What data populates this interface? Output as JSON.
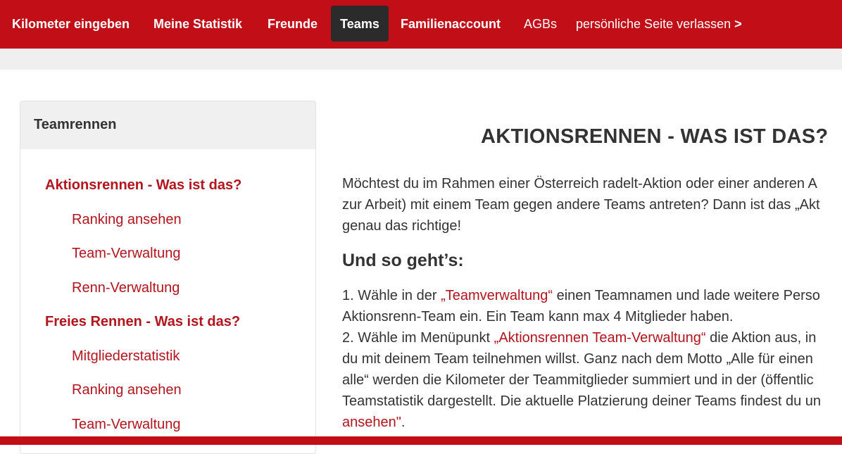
{
  "nav": {
    "items": [
      {
        "label": "Kilometer eingeben"
      },
      {
        "label": "Meine Statistik"
      },
      {
        "label": "Freunde"
      },
      {
        "label": "Teams"
      },
      {
        "label": "Familienaccount"
      },
      {
        "label": "AGBs"
      },
      {
        "label": "persönliche Seite verlassen",
        "arrow": ">"
      }
    ]
  },
  "sidebar": {
    "title": "Teamrennen",
    "items": [
      {
        "label": "Aktionsrennen - Was ist das?"
      },
      {
        "label": "Ranking ansehen"
      },
      {
        "label": "Team-Verwaltung"
      },
      {
        "label": "Renn-Verwaltung"
      },
      {
        "label": "Freies Rennen - Was ist das?"
      },
      {
        "label": "Mitgliederstatistik"
      },
      {
        "label": "Ranking ansehen"
      },
      {
        "label": "Team-Verwaltung"
      }
    ]
  },
  "main": {
    "title": "AKTIONSRENNEN - WAS IST DAS?",
    "intro": {
      "line1": "Möchtest du im Rahmen einer Österreich radelt-Aktion oder einer anderen A",
      "line2": "zur Arbeit) mit einem Team gegen andere Teams antreten? Dann ist das „Akt",
      "line3": "genau das richtige!"
    },
    "subheading": "Und so geht’s:",
    "steps": {
      "l1_pre": "1. Wähle in der ",
      "l1_link": "„Teamverwaltung“",
      "l1_post": " einen Teamnamen und lade weitere Perso",
      "l2": "Aktionsrenn-Team ein. Ein Team kann max 4 Mitglieder haben.",
      "l3_pre": "2. Wähle im Menüpunkt ",
      "l3_link": "„Aktionsrennen Team-Verwaltung“",
      "l3_post": " die Aktion aus, in",
      "l4": "du mit deinem Team teilnehmen willst. Ganz nach dem Motto „Alle für einen",
      "l5": "alle“ werden die Kilometer der Teammitglieder summiert und in der (öffentlic",
      "l6": "Teamstatistik dargestellt. Die aktuelle Platzierung deiner Teams findest du un",
      "l7_link": "ansehen\"",
      "l7_post": "."
    }
  },
  "colors": {
    "brand_red": "#c20e16",
    "link_red": "#b3141d",
    "active_tab": "#2b2b2b"
  }
}
